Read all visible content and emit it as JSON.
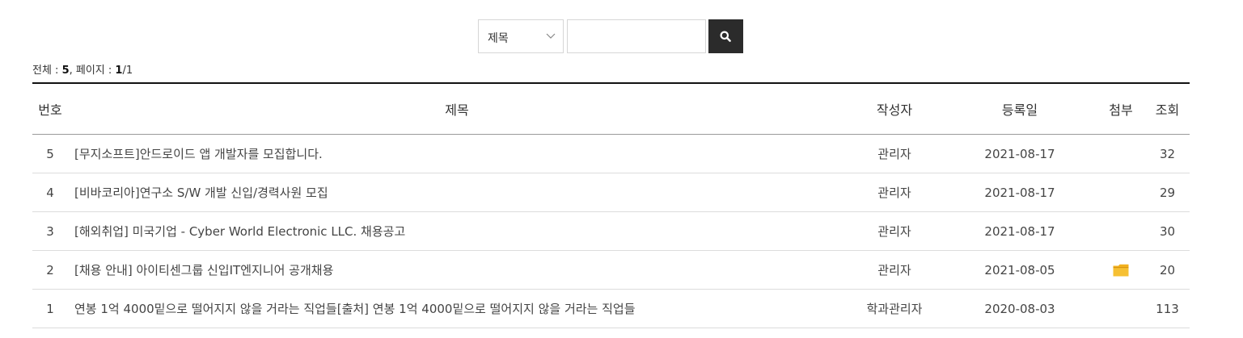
{
  "search": {
    "select_value": "제목",
    "input_value": "",
    "input_placeholder": ""
  },
  "summary": {
    "total_label": "전체 : ",
    "total_count": "5",
    "page_label": ", 페이지 : ",
    "current_page": "1",
    "total_pages": "/1"
  },
  "table": {
    "headers": {
      "no": "번호",
      "title": "제목",
      "writer": "작성자",
      "date": "등록일",
      "file": "첨부",
      "views": "조회"
    },
    "rows": [
      {
        "no": "5",
        "title": "[무지소프트]안드로이드 앱 개발자를 모집합니다.",
        "writer": "관리자",
        "date": "2021-08-17",
        "attachment": false,
        "views": "32"
      },
      {
        "no": "4",
        "title": "[비바코리아]연구소 S/W 개발 신입/경력사원 모집",
        "writer": "관리자",
        "date": "2021-08-17",
        "attachment": false,
        "views": "29"
      },
      {
        "no": "3",
        "title": "[해외취업] 미국기업 - Cyber World Electronic LLC. 채용공고",
        "writer": "관리자",
        "date": "2021-08-17",
        "attachment": false,
        "views": "30"
      },
      {
        "no": "2",
        "title": "[채용 안내] 아이티센그룹 신입IT엔지니어 공개채용",
        "writer": "관리자",
        "date": "2021-08-05",
        "attachment": true,
        "views": "20"
      },
      {
        "no": "1",
        "title": "연봉 1억 4000밑으로 떨어지지 않을 거라는 직업들[출처] 연봉 1억 4000밑으로 떨어지지 않을 거라는 직업들",
        "writer": "학과관리자",
        "date": "2020-08-03",
        "attachment": false,
        "views": "113"
      }
    ]
  },
  "icons": {
    "search": "search-icon",
    "select_arrow": "chevron-down-icon",
    "attachment": "folder-icon"
  },
  "colors": {
    "search_button_bg": "#2b2b2b",
    "attachment_folder": "#f2b01e",
    "header_rule": "#111111"
  }
}
